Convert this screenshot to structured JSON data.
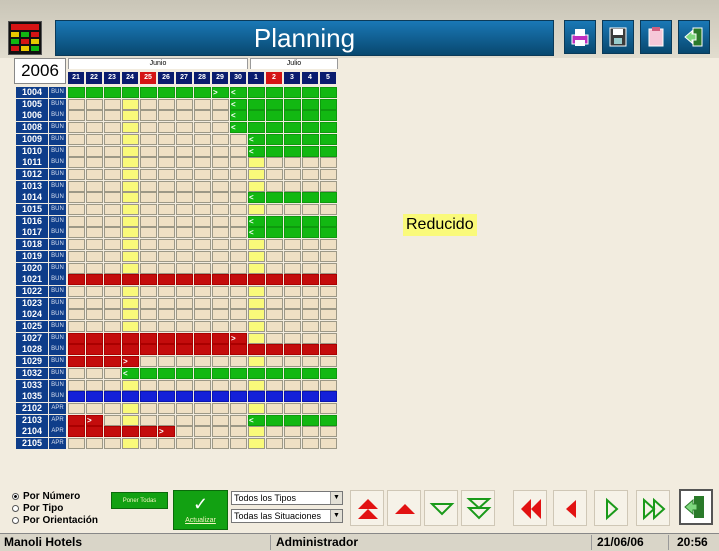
{
  "header": {
    "title": "Planning"
  },
  "toolbar": [
    {
      "name": "print-icon"
    },
    {
      "name": "save-icon"
    },
    {
      "name": "clipboard-icon"
    },
    {
      "name": "exit-icon"
    }
  ],
  "calendar": {
    "year": "2006",
    "months": [
      {
        "label": "Junio"
      },
      {
        "label": "Julio"
      }
    ],
    "days": [
      "21",
      "22",
      "23",
      "24",
      "25",
      "26",
      "27",
      "28",
      "29",
      "30",
      "1",
      "2",
      "3",
      "4",
      "5"
    ],
    "highlight_days": [
      "25",
      "2"
    ],
    "rooms": [
      {
        "num": "1004",
        "type": "BUN"
      },
      {
        "num": "1005",
        "type": "BUN"
      },
      {
        "num": "1006",
        "type": "BUN"
      },
      {
        "num": "1008",
        "type": "BUN"
      },
      {
        "num": "1009",
        "type": "BUN"
      },
      {
        "num": "1010",
        "type": "BUN"
      },
      {
        "num": "1011",
        "type": "BUN"
      },
      {
        "num": "1012",
        "type": "BUN"
      },
      {
        "num": "1013",
        "type": "BUN"
      },
      {
        "num": "1014",
        "type": "BUN"
      },
      {
        "num": "1015",
        "type": "BUN"
      },
      {
        "num": "1016",
        "type": "BUN"
      },
      {
        "num": "1017",
        "type": "BUN"
      },
      {
        "num": "1018",
        "type": "BUN"
      },
      {
        "num": "1019",
        "type": "BUN"
      },
      {
        "num": "1020",
        "type": "BUN"
      },
      {
        "num": "1021",
        "type": "BUN"
      },
      {
        "num": "1022",
        "type": "BUN"
      },
      {
        "num": "1023",
        "type": "BUN"
      },
      {
        "num": "1024",
        "type": "BUN"
      },
      {
        "num": "1025",
        "type": "BUN"
      },
      {
        "num": "1027",
        "type": "BUN"
      },
      {
        "num": "1028",
        "type": "BUN"
      },
      {
        "num": "1029",
        "type": "BUN"
      },
      {
        "num": "1032",
        "type": "BUN"
      },
      {
        "num": "1033",
        "type": "BUN"
      },
      {
        "num": "1035",
        "type": "BUN"
      },
      {
        "num": "2102",
        "type": "APR"
      },
      {
        "num": "2103",
        "type": "APR"
      },
      {
        "num": "2104",
        "type": "APR"
      },
      {
        "num": "2105",
        "type": "APR"
      }
    ],
    "bookings": [
      {
        "room": "1004",
        "status": "green",
        "from": "21",
        "to": "29",
        "end_mark": ">"
      },
      {
        "room": "1004",
        "status": "green",
        "from": "30",
        "to": "5",
        "start_mark": "<"
      },
      {
        "room": "1005",
        "status": "green",
        "from": "30",
        "to": "5",
        "start_mark": "<"
      },
      {
        "room": "1006",
        "status": "green",
        "from": "30",
        "to": "5",
        "start_mark": "<"
      },
      {
        "room": "1008",
        "status": "green",
        "from": "30",
        "to": "5",
        "start_mark": "<"
      },
      {
        "room": "1009",
        "status": "green",
        "from": "1",
        "to": "5",
        "start_mark": "<"
      },
      {
        "room": "1010",
        "status": "green",
        "from": "1",
        "to": "5",
        "start_mark": "<"
      },
      {
        "room": "1014",
        "status": "green",
        "from": "1",
        "to": "5",
        "start_mark": "<"
      },
      {
        "room": "1016",
        "status": "green",
        "from": "1",
        "to": "5",
        "start_mark": "<"
      },
      {
        "room": "1017",
        "status": "green",
        "from": "1",
        "to": "5",
        "start_mark": "<"
      },
      {
        "room": "1021",
        "status": "red",
        "from": "21",
        "to": "5"
      },
      {
        "room": "1027",
        "status": "red",
        "from": "21",
        "to": "30",
        "end_mark": ">"
      },
      {
        "room": "1028",
        "status": "red",
        "from": "21",
        "to": "5"
      },
      {
        "room": "1029",
        "status": "red",
        "from": "21",
        "to": "24",
        "end_mark": ">"
      },
      {
        "room": "1032",
        "status": "green",
        "from": "24",
        "to": "5",
        "start_mark": "<"
      },
      {
        "room": "1035",
        "status": "blue",
        "from": "21",
        "to": "5"
      },
      {
        "room": "2103",
        "status": "red",
        "from": "21",
        "to": "22",
        "end_mark": ">"
      },
      {
        "room": "2103",
        "status": "green",
        "from": "1",
        "to": "5",
        "start_mark": "<"
      },
      {
        "room": "2104",
        "status": "red",
        "from": "21",
        "to": "26",
        "end_mark": ">"
      }
    ],
    "colors": {
      "green": "#12b812",
      "red": "#c40c0c",
      "blue": "#1420d8",
      "free": "#efe0c4",
      "today": "#fafa7a",
      "room_label": "#0e3d8a",
      "header_day": "#0a1c6e",
      "weekend_day": "#d41414"
    }
  },
  "side_panel": {
    "mode_label": "Reducido"
  },
  "sort_options": [
    {
      "label": "Por Número",
      "selected": true
    },
    {
      "label": "Por Tipo",
      "selected": false
    },
    {
      "label": "Por Orientación",
      "selected": false
    }
  ],
  "buttons": {
    "poner_todas": "Poner Todas",
    "actualizar": "Actualizar"
  },
  "filters": {
    "tipos": "Todos los Tipos",
    "situaciones": "Todas las Situaciones"
  },
  "nav": [
    {
      "name": "first-page-icon"
    },
    {
      "name": "page-up-icon"
    },
    {
      "name": "page-down-icon"
    },
    {
      "name": "last-page-icon"
    },
    {
      "name": "rewind-icon"
    },
    {
      "name": "previous-icon"
    },
    {
      "name": "next-icon"
    },
    {
      "name": "fast-forward-icon"
    },
    {
      "name": "exit-icon"
    }
  ],
  "status": {
    "company": "Manoli Hotels",
    "user": "Administrador",
    "date": "21/06/06",
    "time": "20:56"
  }
}
